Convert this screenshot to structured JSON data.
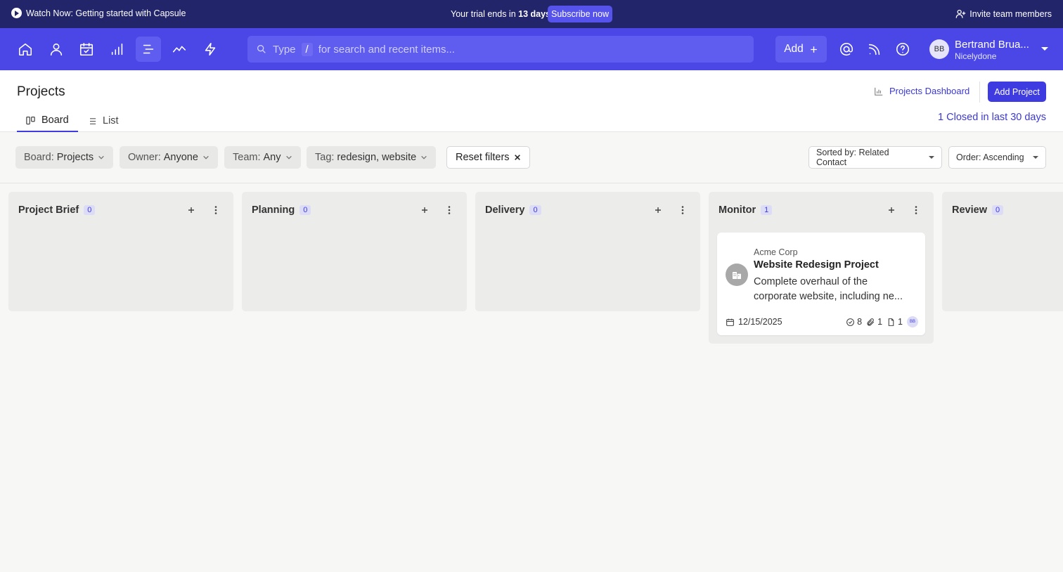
{
  "banner": {
    "watch_label": "Watch Now: Getting started with Capsule",
    "trial_prefix": "Your trial ends in",
    "trial_days": "13 days",
    "subscribe_label": "Subscribe now",
    "invite_label": "Invite team members"
  },
  "nav": {
    "search_prefix": "Type",
    "search_key": "/",
    "search_placeholder": "for search and recent items...",
    "add_label": "Add",
    "user_initials": "BB",
    "user_name": "Bertrand Brua...",
    "user_org": "Nicelydone",
    "icons": [
      "home-icon",
      "person-icon",
      "calendar-check-icon",
      "bar-chart-icon",
      "projects-icon",
      "activity-icon",
      "lightning-icon",
      "at-icon",
      "broadcast-icon",
      "help-icon"
    ]
  },
  "page": {
    "title": "Projects",
    "dashboard_link": "Projects Dashboard",
    "add_project_label": "Add Project",
    "tabs": [
      {
        "label": "Board",
        "active": true
      },
      {
        "label": "List",
        "active": false
      }
    ],
    "closed_summary": "1 Closed in last 30 days"
  },
  "filters": {
    "board": {
      "label": "Board:",
      "value": "Projects"
    },
    "owner": {
      "label": "Owner:",
      "value": "Anyone"
    },
    "team": {
      "label": "Team:",
      "value": "Any"
    },
    "tag": {
      "label": "Tag:",
      "value1": "redesign,",
      "value2": "website"
    },
    "reset_label": "Reset filters",
    "sort_label": "Sorted by: Related Contact",
    "order_label": "Order: Ascending"
  },
  "columns": [
    {
      "name": "Project Brief",
      "count": "0"
    },
    {
      "name": "Planning",
      "count": "0"
    },
    {
      "name": "Delivery",
      "count": "0"
    },
    {
      "name": "Monitor",
      "count": "1"
    },
    {
      "name": "Review",
      "count": "0"
    }
  ],
  "card": {
    "company": "Acme Corp",
    "title": "Website Redesign Project",
    "description_line1": "Complete overhaul of the",
    "description_line2": "corporate website, including ne...",
    "date": "12/15/2025",
    "tasks": "8",
    "attachments": "1",
    "files": "1",
    "owner_initials": "BB"
  },
  "colors": {
    "banner_bg": "#23256b",
    "nav_bg": "#4a47e6",
    "accent": "#3e3be0",
    "column_bg": "#ececeb"
  }
}
